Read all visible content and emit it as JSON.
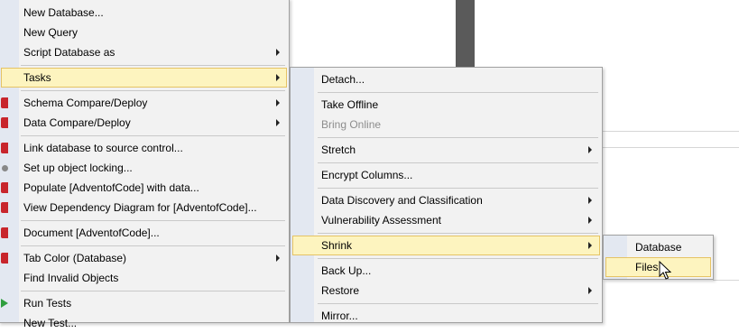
{
  "context_menu": {
    "items": [
      {
        "label": "New Database..."
      },
      {
        "label": "New Query"
      },
      {
        "label": "Script Database as"
      },
      {
        "label": "Tasks"
      },
      {
        "label": "Schema Compare/Deploy"
      },
      {
        "label": "Data Compare/Deploy"
      },
      {
        "label": "Link database to source control..."
      },
      {
        "label": "Set up object locking..."
      },
      {
        "label": "Populate [AdventofCode] with data..."
      },
      {
        "label": "View Dependency Diagram for [AdventofCode]..."
      },
      {
        "label": "Document [AdventofCode]..."
      },
      {
        "label": "Tab Color (Database)"
      },
      {
        "label": "Find Invalid Objects"
      },
      {
        "label": "Run Tests"
      },
      {
        "label": "New Test..."
      }
    ]
  },
  "tasks_menu": {
    "items": [
      {
        "label": "Detach..."
      },
      {
        "label": "Take Offline"
      },
      {
        "label": "Bring Online"
      },
      {
        "label": "Stretch"
      },
      {
        "label": "Encrypt Columns..."
      },
      {
        "label": "Data Discovery and Classification"
      },
      {
        "label": "Vulnerability Assessment"
      },
      {
        "label": "Shrink"
      },
      {
        "label": "Back Up..."
      },
      {
        "label": "Restore"
      },
      {
        "label": "Mirror..."
      }
    ]
  },
  "shrink_menu": {
    "items": [
      {
        "label": "Database"
      },
      {
        "label": "Files"
      }
    ]
  },
  "icons": {
    "submenu_arrow": "chevron-right-icon",
    "redgate": "redgate-icon",
    "gear": "gear-icon",
    "run": "play-icon",
    "cursor": "mouse-pointer-icon"
  },
  "colors": {
    "highlight": "#fdf4bf",
    "highlight_border": "#e5c365",
    "gutter": "#e3e8f1",
    "menu_bg": "#f2f2f2",
    "disabled_text": "#8d8d8d",
    "redgate_red": "#c8252c"
  }
}
